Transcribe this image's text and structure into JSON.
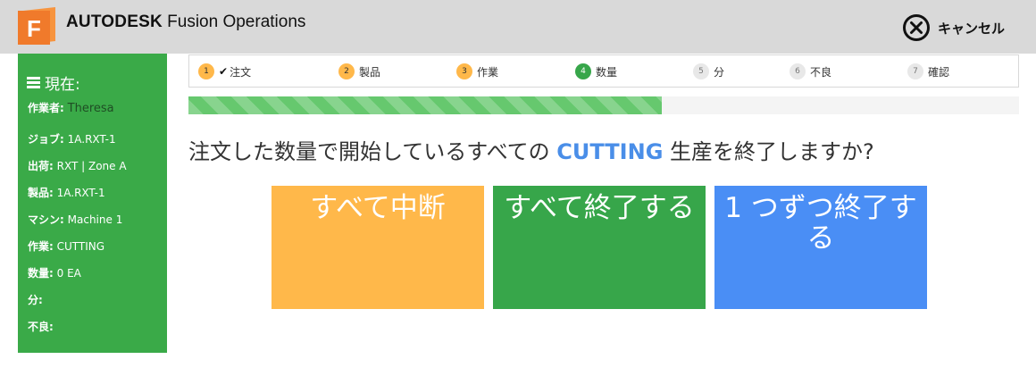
{
  "header": {
    "brand_strong": "AUTODESK",
    "brand_product": " Fusion Operations",
    "logo_letter": "F",
    "cancel_label": "キャンセル",
    "colors": {
      "background": "#d9d9d9",
      "logo": "#f07a2b"
    }
  },
  "sidebar": {
    "title": "現在:",
    "rows": [
      {
        "key": "作業者:",
        "value": "Theresa"
      },
      {
        "key": "ジョブ:",
        "value": "1A.RXT-1"
      },
      {
        "key": "出荷:",
        "value": "RXT | Zone A"
      },
      {
        "key": "製品:",
        "value": "1A.RXT-1"
      },
      {
        "key": "マシン:",
        "value": "Machine 1"
      },
      {
        "key": "作業:",
        "value": "CUTTING"
      },
      {
        "key": "数量:",
        "value": "0 EA"
      },
      {
        "key": "分:",
        "value": ""
      },
      {
        "key": "不良:",
        "value": ""
      }
    ],
    "color": "#3aaa48"
  },
  "steps": [
    {
      "num": "1",
      "label": "注文",
      "state": "done",
      "checked": true
    },
    {
      "num": "2",
      "label": "製品",
      "state": "done"
    },
    {
      "num": "3",
      "label": "作業",
      "state": "done"
    },
    {
      "num": "4",
      "label": "数量",
      "state": "active"
    },
    {
      "num": "5",
      "label": "分",
      "state": "todo"
    },
    {
      "num": "6",
      "label": "不良",
      "state": "todo"
    },
    {
      "num": "7",
      "label": "確認",
      "state": "todo"
    }
  ],
  "progress": {
    "percent": 57
  },
  "question": {
    "before": "注文した数量で開始しているすべての ",
    "highlight": "CUTTING",
    "after": " 生産を終了しますか?"
  },
  "actions": {
    "pause_all": "すべて中断",
    "finish_all": "すべて終了する",
    "finish_one": "1 つずつ終了する",
    "colors": {
      "pause": "#ffb84a",
      "finish_all": "#37a64a",
      "finish_one": "#4a8ef5"
    }
  }
}
